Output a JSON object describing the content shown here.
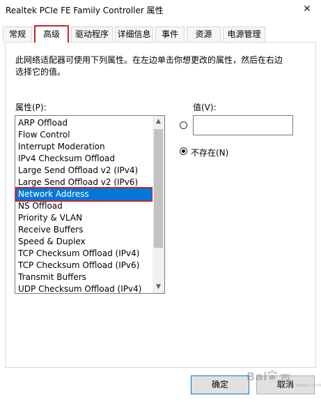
{
  "window": {
    "title": "Realtek PCIe FE Family Controller 属性",
    "close_glyph": "✕"
  },
  "tabs": [
    {
      "label": "常规",
      "active": false
    },
    {
      "label": "高级",
      "active": true
    },
    {
      "label": "驱动程序",
      "active": false
    },
    {
      "label": "详细信息",
      "active": false
    },
    {
      "label": "事件",
      "active": false
    },
    {
      "label": "资源",
      "active": false
    },
    {
      "label": "电源管理",
      "active": false
    }
  ],
  "description": "此网络适配器可使用下列属性。在左边单击你想更改的属性，然后在右边选择它的值。",
  "property_label": "属性(P):",
  "value_label": "值(V):",
  "properties": [
    "ARP Offload",
    "Flow Control",
    "Interrupt Moderation",
    "IPv4 Checksum Offload",
    "Large Send Offload v2 (IPv4)",
    "Large Send Offload v2 (IPv6)",
    "Network Address",
    "NS Offload",
    "Priority & VLAN",
    "Receive Buffers",
    "Speed & Duplex",
    "TCP Checksum Offload (IPv4)",
    "TCP Checksum Offload (IPv6)",
    "Transmit Buffers",
    "UDP Checksum Offload (IPv4)"
  ],
  "selected_property": "Network Address",
  "value_input": "",
  "not_present_label": "不存在(N)",
  "not_present_checked": true,
  "buttons": {
    "ok": "确定",
    "cancel": "取消"
  },
  "watermark": {
    "text": "Bai",
    "text2": "百",
    "sub": "jingyan.baidu.com"
  },
  "colors": {
    "selection": "#0078d7",
    "highlight_box": "#d0202e"
  }
}
